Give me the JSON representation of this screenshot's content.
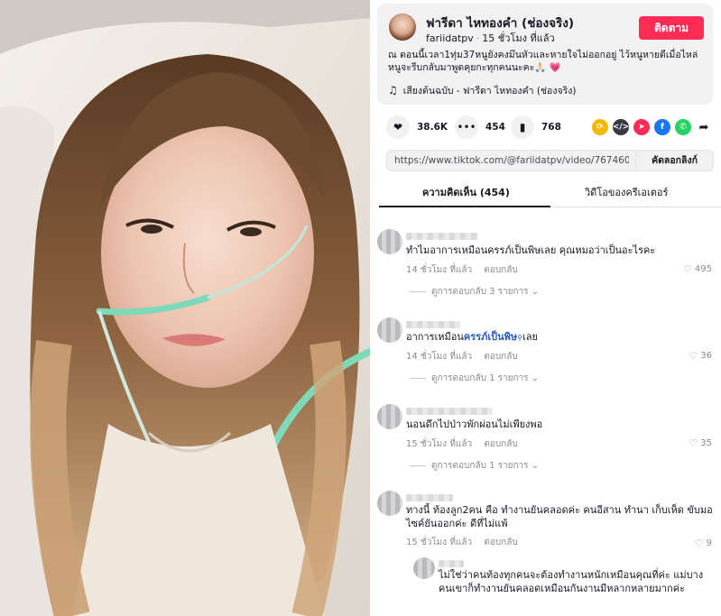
{
  "author": {
    "name": "ฟารีดา ไหทองคำ (ช่องจริง)",
    "handle": "fariidatpv",
    "time": "15 ชั่วโมง ที่แล้ว",
    "follow_label": "ติดตาม"
  },
  "caption": "ณ ตอนนี้เวลา1ทุ่ม37หนูยังคงมึนหัวและหายใจไม่ออกอยู่ ไว้หนูหายดีเมื่อไหล่หนูจะรีบกลับมาพูดคุยกะทุกคนนะคะ🙏🏻 💗",
  "music": "เสียงต้นฉบับ - ฟารีดา ไหทองคำ (ช่องจริง)",
  "stats": {
    "likes": "38.6K",
    "comments": "454",
    "saves": "768"
  },
  "share_icons": [
    "embed-icon",
    "code-icon",
    "send-icon",
    "facebook-icon",
    "whatsapp-icon",
    "share-arrow-icon"
  ],
  "link": {
    "url": "https://www.tiktok.com/@fariidatpv/video/767460778...",
    "copy_label": "คัดลอกลิงก์"
  },
  "tabs": {
    "comments": "ความคิดเห็น (454)",
    "creator_videos": "วิดีโอของครีเอเตอร์"
  },
  "comments": [
    {
      "text_a": "ทำไมอาการเหมือนครรภ์เป็นพิษเลย คุณหมอว่าเป็นอะไรคะ",
      "time": "14 ชั่วโมง ที่แล้ว",
      "reply": "ตอบกลับ",
      "likes": "495",
      "view_replies": "ดูการตอบกลับ 3 รายการ"
    },
    {
      "text_a": "อาการเหมือน",
      "text_hl": "ครรภ์เป็นพิษ",
      "text_b": "เลย",
      "time": "14 ชั่วโมง ที่แล้ว",
      "reply": "ตอบกลับ",
      "likes": "36",
      "view_replies": "ดูการตอบกลับ 1 รายการ"
    },
    {
      "text_a": "นอนดึกไปป่าวพักผ่อนไม่เพียงพอ",
      "time": "15 ชั่วโมง ที่แล้ว",
      "reply": "ตอบกลับ",
      "likes": "35",
      "view_replies": "ดูการตอบกลับ 1 รายการ"
    },
    {
      "text_a": "ทางนี้ ท้องลูก2คน คือ ทำงานยันคลอดค่ะ คนอีสาน ทำนา เก็บเห็ด ขับมอไซค์ยันออกค่ะ ดีที่ไม่แพ้",
      "time": "15 ชั่วโมง ที่แล้ว",
      "reply": "ตอบกลับ",
      "likes": "9"
    }
  ],
  "sub_reply": {
    "text": "ไม่ใช่ว่าคนท้องทุกคนจะต้องทำงานหนักเหมือนคุณที่ค่ะ แม่บางคนเขาก็ทำงานยันคลอดเหมือนกันงานมีหลากหลายมากค่ะ"
  },
  "colors": {
    "follow": "#fe2c55",
    "highlight": "#2b5db9",
    "muted": "#8a8b91"
  }
}
